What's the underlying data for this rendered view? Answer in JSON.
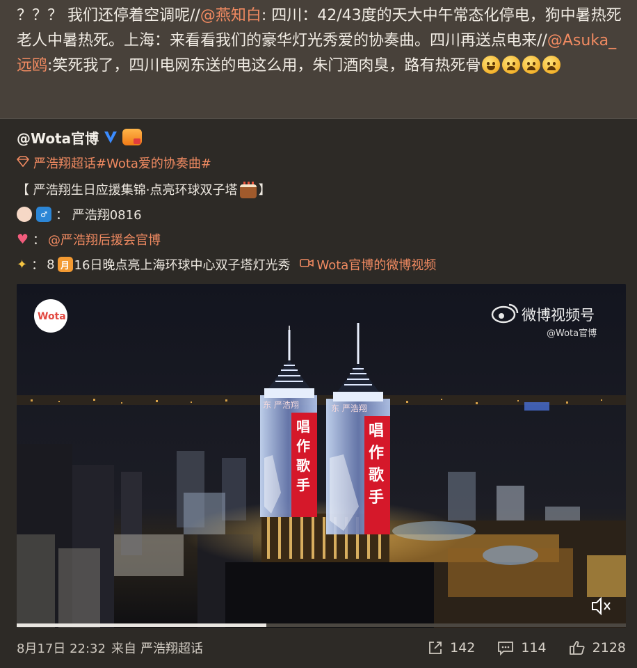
{
  "repost_text": {
    "part1": "？？？ 我们还停着空调呢//",
    "mention1": "@燕知白",
    "part2": ": 四川：42/43度的天大中午常态化停电，狗中暑热死老人中暑热死。上海：来看看我们的豪华灯光秀爱的协奏曲。四川再送点电来//",
    "mention2": "@Asuka_远鸥",
    "part3": ":笑死我了，四川电网东送的电这么用，朱门酒肉臭，路有热死骨",
    "emojis": [
      "smile-emoji",
      "cry-emoji",
      "cry-emoji",
      "cry-emoji"
    ]
  },
  "post": {
    "username": "@Wota官博",
    "verified_icon": "verified-v-icon",
    "topic_line": "严浩翔超话#Wota爱的协奏曲#",
    "title_line": "【 严浩翔生日应援集锦·点亮环球双子塔",
    "title_close": "】",
    "title_tag": "OBJ",
    "star_line": "： 严浩翔0816",
    "support_mention": "@严浩翔后援会官博",
    "support_prefix": "：",
    "event_num": "8",
    "event_cal": "月",
    "event_text": "16日晚点亮上海环球中心双子塔灯光秀",
    "video_link": "Wota官博的微博视频",
    "colors": {
      "accent": "#f08a61",
      "background": "#2d2a26",
      "quote_bg": "#48413a"
    }
  },
  "video": {
    "logo_text": "Wota",
    "watermark_title": "微博视频号",
    "watermark_user": "@Wota官博",
    "tower_text_left": [
      "唱",
      "作",
      "歌",
      "手"
    ],
    "tower_text_right": [
      "唱",
      "作",
      "歌",
      "手"
    ],
    "tower_top_left": "东 严浩翔",
    "tower_top_right": "东 严浩翔",
    "progress": 0.41,
    "mute_icon": "speaker-muted-icon"
  },
  "footer": {
    "date": "8月17日 22:32",
    "source_prefix": "来自",
    "source": "严浩翔超话",
    "reposts": "142",
    "comments": "114",
    "likes": "2128"
  }
}
